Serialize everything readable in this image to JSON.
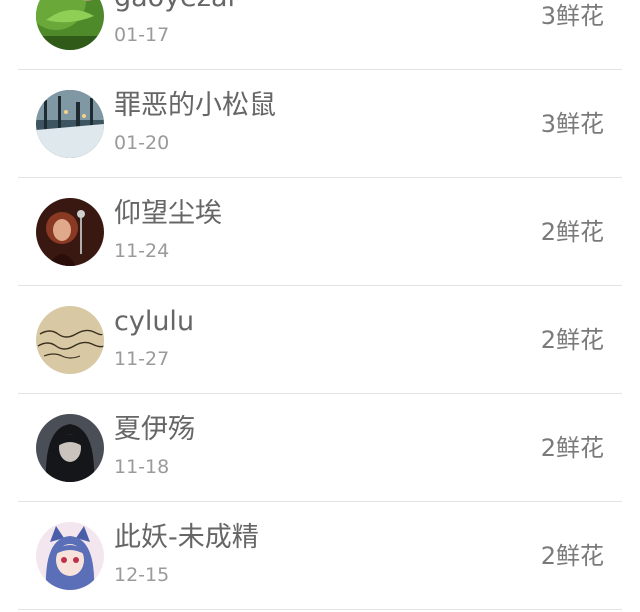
{
  "rows": [
    {
      "name": "gaoyezai",
      "date": "01-17",
      "flowers": "3鲜花",
      "avatar_icon": "leaf-photo"
    },
    {
      "name": "罪恶的小松鼠",
      "date": "01-20",
      "flowers": "3鲜花",
      "avatar_icon": "winter-street-photo"
    },
    {
      "name": "仰望尘埃",
      "date": "11-24",
      "flowers": "2鲜花",
      "avatar_icon": "singer-photo"
    },
    {
      "name": "cylulu",
      "date": "11-27",
      "flowers": "2鲜花",
      "avatar_icon": "handwriting-photo"
    },
    {
      "name": "夏伊殇",
      "date": "11-18",
      "flowers": "2鲜花",
      "avatar_icon": "dark-hair-girl-photo"
    },
    {
      "name": "此妖-未成精",
      "date": "12-15",
      "flowers": "2鲜花",
      "avatar_icon": "anime-catgirl-photo"
    }
  ]
}
